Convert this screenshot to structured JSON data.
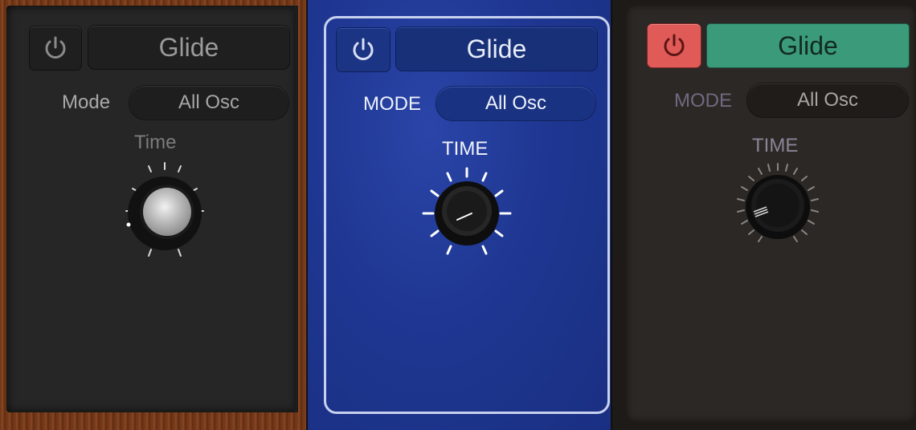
{
  "panels": [
    {
      "title": "Glide",
      "mode_label": "Mode",
      "mode_value": "All Osc",
      "time_label": "Time",
      "power_icon": "power-icon",
      "time_value": 0.1
    },
    {
      "title": "Glide",
      "mode_label": "MODE",
      "mode_value": "All Osc",
      "time_label": "TIME",
      "power_icon": "power-icon",
      "time_value": 0.15
    },
    {
      "title": "Glide",
      "mode_label": "MODE",
      "mode_value": "All Osc",
      "time_label": "TIME",
      "power_icon": "power-icon",
      "time_value": 0.1
    }
  ],
  "colors": {
    "panel1_bg": "#262626",
    "panel2_bg": "#1f3792",
    "panel3_bg": "#2c2825",
    "panel3_power_active": "#e05a57",
    "panel3_title_active": "#3a9a7a"
  }
}
